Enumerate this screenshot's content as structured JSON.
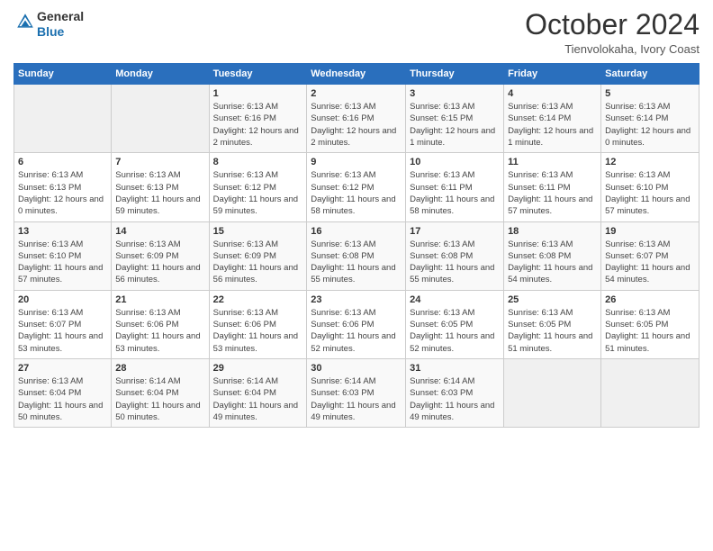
{
  "logo": {
    "general": "General",
    "blue": "Blue"
  },
  "header": {
    "month": "October 2024",
    "location": "Tienvolokaha, Ivory Coast"
  },
  "weekdays": [
    "Sunday",
    "Monday",
    "Tuesday",
    "Wednesday",
    "Thursday",
    "Friday",
    "Saturday"
  ],
  "weeks": [
    [
      {
        "day": "",
        "info": ""
      },
      {
        "day": "",
        "info": ""
      },
      {
        "day": "1",
        "info": "Sunrise: 6:13 AM\nSunset: 6:16 PM\nDaylight: 12 hours and 2 minutes."
      },
      {
        "day": "2",
        "info": "Sunrise: 6:13 AM\nSunset: 6:16 PM\nDaylight: 12 hours and 2 minutes."
      },
      {
        "day": "3",
        "info": "Sunrise: 6:13 AM\nSunset: 6:15 PM\nDaylight: 12 hours and 1 minute."
      },
      {
        "day": "4",
        "info": "Sunrise: 6:13 AM\nSunset: 6:14 PM\nDaylight: 12 hours and 1 minute."
      },
      {
        "day": "5",
        "info": "Sunrise: 6:13 AM\nSunset: 6:14 PM\nDaylight: 12 hours and 0 minutes."
      }
    ],
    [
      {
        "day": "6",
        "info": "Sunrise: 6:13 AM\nSunset: 6:13 PM\nDaylight: 12 hours and 0 minutes."
      },
      {
        "day": "7",
        "info": "Sunrise: 6:13 AM\nSunset: 6:13 PM\nDaylight: 11 hours and 59 minutes."
      },
      {
        "day": "8",
        "info": "Sunrise: 6:13 AM\nSunset: 6:12 PM\nDaylight: 11 hours and 59 minutes."
      },
      {
        "day": "9",
        "info": "Sunrise: 6:13 AM\nSunset: 6:12 PM\nDaylight: 11 hours and 58 minutes."
      },
      {
        "day": "10",
        "info": "Sunrise: 6:13 AM\nSunset: 6:11 PM\nDaylight: 11 hours and 58 minutes."
      },
      {
        "day": "11",
        "info": "Sunrise: 6:13 AM\nSunset: 6:11 PM\nDaylight: 11 hours and 57 minutes."
      },
      {
        "day": "12",
        "info": "Sunrise: 6:13 AM\nSunset: 6:10 PM\nDaylight: 11 hours and 57 minutes."
      }
    ],
    [
      {
        "day": "13",
        "info": "Sunrise: 6:13 AM\nSunset: 6:10 PM\nDaylight: 11 hours and 57 minutes."
      },
      {
        "day": "14",
        "info": "Sunrise: 6:13 AM\nSunset: 6:09 PM\nDaylight: 11 hours and 56 minutes."
      },
      {
        "day": "15",
        "info": "Sunrise: 6:13 AM\nSunset: 6:09 PM\nDaylight: 11 hours and 56 minutes."
      },
      {
        "day": "16",
        "info": "Sunrise: 6:13 AM\nSunset: 6:08 PM\nDaylight: 11 hours and 55 minutes."
      },
      {
        "day": "17",
        "info": "Sunrise: 6:13 AM\nSunset: 6:08 PM\nDaylight: 11 hours and 55 minutes."
      },
      {
        "day": "18",
        "info": "Sunrise: 6:13 AM\nSunset: 6:08 PM\nDaylight: 11 hours and 54 minutes."
      },
      {
        "day": "19",
        "info": "Sunrise: 6:13 AM\nSunset: 6:07 PM\nDaylight: 11 hours and 54 minutes."
      }
    ],
    [
      {
        "day": "20",
        "info": "Sunrise: 6:13 AM\nSunset: 6:07 PM\nDaylight: 11 hours and 53 minutes."
      },
      {
        "day": "21",
        "info": "Sunrise: 6:13 AM\nSunset: 6:06 PM\nDaylight: 11 hours and 53 minutes."
      },
      {
        "day": "22",
        "info": "Sunrise: 6:13 AM\nSunset: 6:06 PM\nDaylight: 11 hours and 53 minutes."
      },
      {
        "day": "23",
        "info": "Sunrise: 6:13 AM\nSunset: 6:06 PM\nDaylight: 11 hours and 52 minutes."
      },
      {
        "day": "24",
        "info": "Sunrise: 6:13 AM\nSunset: 6:05 PM\nDaylight: 11 hours and 52 minutes."
      },
      {
        "day": "25",
        "info": "Sunrise: 6:13 AM\nSunset: 6:05 PM\nDaylight: 11 hours and 51 minutes."
      },
      {
        "day": "26",
        "info": "Sunrise: 6:13 AM\nSunset: 6:05 PM\nDaylight: 11 hours and 51 minutes."
      }
    ],
    [
      {
        "day": "27",
        "info": "Sunrise: 6:13 AM\nSunset: 6:04 PM\nDaylight: 11 hours and 50 minutes."
      },
      {
        "day": "28",
        "info": "Sunrise: 6:14 AM\nSunset: 6:04 PM\nDaylight: 11 hours and 50 minutes."
      },
      {
        "day": "29",
        "info": "Sunrise: 6:14 AM\nSunset: 6:04 PM\nDaylight: 11 hours and 49 minutes."
      },
      {
        "day": "30",
        "info": "Sunrise: 6:14 AM\nSunset: 6:03 PM\nDaylight: 11 hours and 49 minutes."
      },
      {
        "day": "31",
        "info": "Sunrise: 6:14 AM\nSunset: 6:03 PM\nDaylight: 11 hours and 49 minutes."
      },
      {
        "day": "",
        "info": ""
      },
      {
        "day": "",
        "info": ""
      }
    ]
  ]
}
